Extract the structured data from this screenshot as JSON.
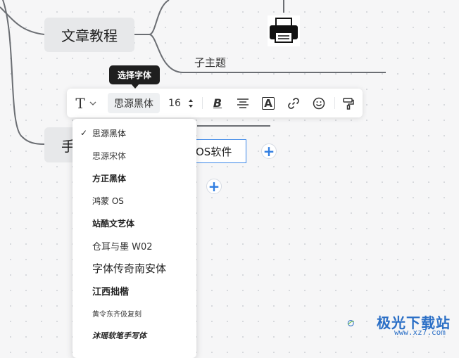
{
  "mindmap": {
    "main_node": "文章教程",
    "hand_node_partial": "手",
    "subtopic": "子主题",
    "os_node_partial": "OS软件",
    "colors": {
      "line": "#6b6e73",
      "node_bg": "#e7e8ea",
      "selection": "#3a86e8"
    }
  },
  "tooltip": {
    "text": "选择字体"
  },
  "toolbar": {
    "text_icon": "T",
    "font_family": "思源黑体",
    "font_size": "16",
    "bold_label": "B",
    "font_color_label": "A"
  },
  "font_dropdown": {
    "items": [
      {
        "label": "思源黑体",
        "selected": true
      },
      {
        "label": "思源宋体",
        "selected": false
      },
      {
        "label": "方正黑体",
        "selected": false
      },
      {
        "label": "鸿蒙 OS",
        "selected": false
      },
      {
        "label": "站酷文艺体",
        "selected": false
      },
      {
        "label": "仓耳与墨 W02",
        "selected": false
      },
      {
        "label": "字体传奇南安体",
        "selected": false
      },
      {
        "label": "江西拙楷",
        "selected": false
      },
      {
        "label": "黄令东齐伋复刻",
        "selected": false
      },
      {
        "label": "沐瑶软笔手写体",
        "selected": false
      }
    ],
    "check_mark": "✓"
  },
  "watermark": {
    "text": "极光下载站",
    "url": "www.xz7.com"
  }
}
